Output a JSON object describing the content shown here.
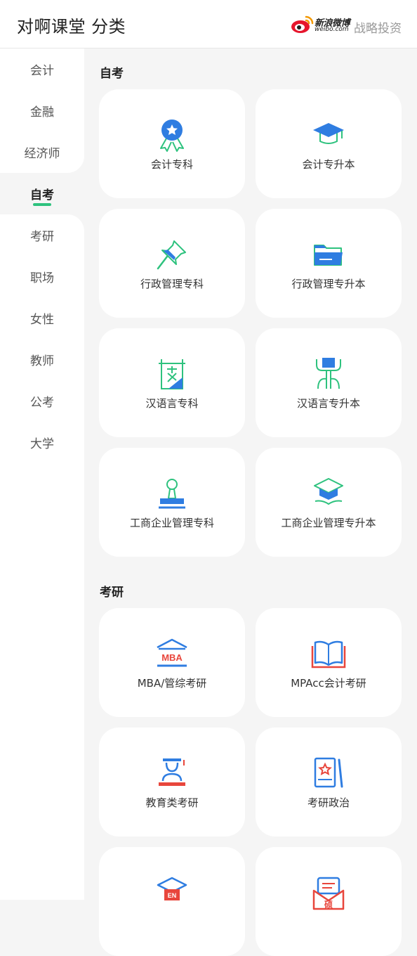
{
  "header": {
    "title": "对啊课堂 分类",
    "logo_cn": "新浪微博",
    "logo_en": "weibo.com",
    "strategy": "战略投资"
  },
  "sidebar": {
    "items": [
      {
        "label": "会计"
      },
      {
        "label": "金融"
      },
      {
        "label": "经济师"
      },
      {
        "label": "自考"
      },
      {
        "label": "考研"
      },
      {
        "label": "职场"
      },
      {
        "label": "女性"
      },
      {
        "label": "教师"
      },
      {
        "label": "公考"
      },
      {
        "label": "大学"
      }
    ],
    "active": "自考"
  },
  "sections": [
    {
      "title": "自考",
      "cards": [
        {
          "label": "会计专科",
          "icon": "award-ribbon-icon"
        },
        {
          "label": "会计专升本",
          "icon": "graduation-cap-icon"
        },
        {
          "label": "行政管理专科",
          "icon": "pushpin-icon"
        },
        {
          "label": "行政管理专升本",
          "icon": "folder-icon"
        },
        {
          "label": "汉语言专科",
          "icon": "chinese-text-frame-icon"
        },
        {
          "label": "汉语言专升本",
          "icon": "chinese-character-icon"
        },
        {
          "label": "工商企业管理专科",
          "icon": "stamp-icon"
        },
        {
          "label": "工商企业管理专升本",
          "icon": "mortarboard-book-icon"
        }
      ]
    },
    {
      "title": "考研",
      "cards": [
        {
          "label": "MBA/管综考研",
          "icon": "mba-building-icon",
          "icon_text": "MBA"
        },
        {
          "label": "MPAcc会计考研",
          "icon": "open-book-icon"
        },
        {
          "label": "教育类考研",
          "icon": "teacher-icon"
        },
        {
          "label": "考研政治",
          "icon": "star-book-icon"
        },
        {
          "label": "",
          "icon": "english-cap-icon",
          "icon_text": "EN"
        },
        {
          "label": "",
          "icon": "envelope-icon",
          "icon_text": "硕"
        }
      ]
    }
  ],
  "colors": {
    "blue": "#2f7de1",
    "green": "#2ec27e",
    "red": "#e8463c",
    "active_bar": "#2ec27e"
  }
}
